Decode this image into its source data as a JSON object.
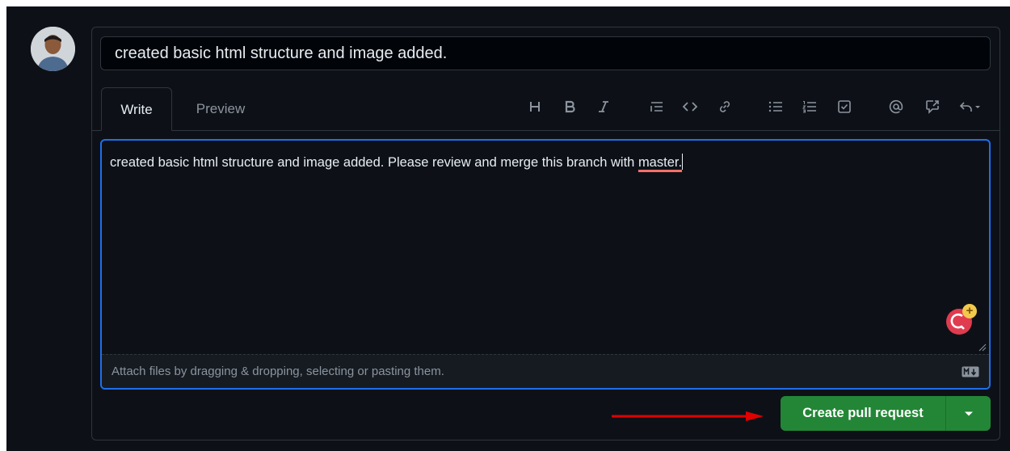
{
  "pr": {
    "title_value": "created basic html structure and image added.",
    "tabs": {
      "write": "Write",
      "preview": "Preview"
    },
    "body": {
      "text_before": "created basic html structure and image added. Please review and merge this branch with ",
      "text_underlined": "master."
    },
    "attach_hint": "Attach files by dragging & dropping, selecting or pasting them.",
    "toolbar": [
      "heading-icon",
      "bold-icon",
      "italic-icon",
      "quote-icon",
      "code-icon",
      "link-icon",
      "unordered-list-icon",
      "ordered-list-icon",
      "task-list-icon",
      "mention-icon",
      "cross-reference-icon",
      "saved-replies-icon"
    ],
    "submit_label": "Create pull request"
  },
  "colors": {
    "accent": "#1f6feb",
    "primary_button": "#238636",
    "background": "#0d1117",
    "annotation_arrow": "#e00000"
  }
}
